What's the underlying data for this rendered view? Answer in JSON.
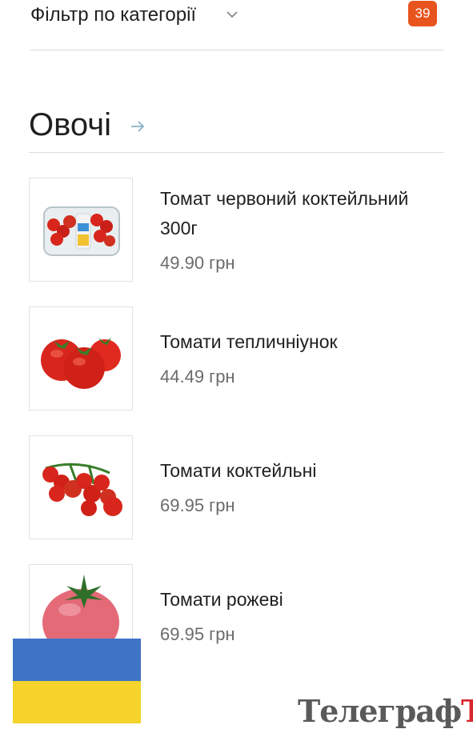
{
  "filter": {
    "label": "Фільтр по категорії",
    "count": "39"
  },
  "section": {
    "title": "Овочі"
  },
  "products": [
    {
      "name": "Томат червоний коктейльний 300г",
      "price": "49.90 грн",
      "icon": "cherry-tomato-pack-image"
    },
    {
      "name": "Томати тепличніунок",
      "price": "44.49 грн",
      "icon": "greenhouse-tomatoes-image"
    },
    {
      "name": "Томати коктейльні",
      "price": "69.95 грн",
      "icon": "cocktail-tomatoes-vine-image"
    },
    {
      "name": "Томати рожеві",
      "price": "69.95 грн",
      "icon": "pink-tomato-image"
    }
  ],
  "watermark": {
    "main": "Телеграф",
    "accent": "Ъ"
  },
  "colors": {
    "badge": "#e8541e",
    "flag_blue": "#3f73c6",
    "flag_yellow": "#f5d32a",
    "tomato_red": "#d8261c",
    "tomato_pink": "#e46a78"
  }
}
